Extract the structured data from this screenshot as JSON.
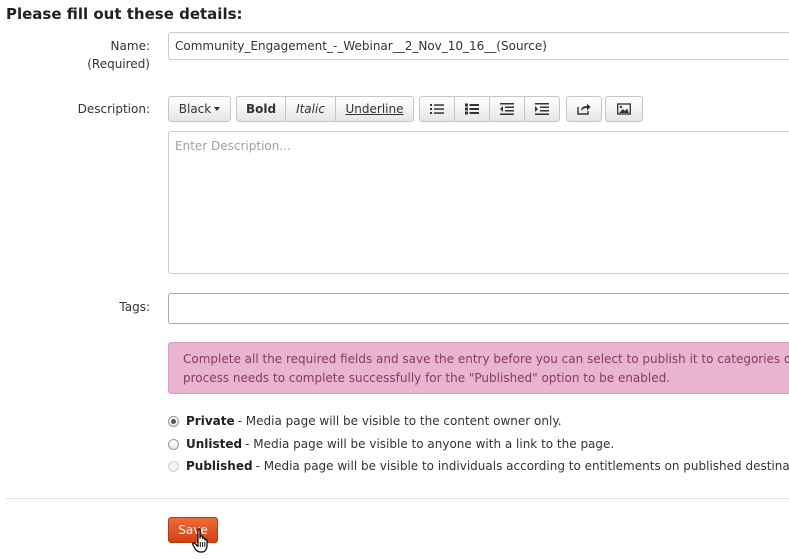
{
  "form": {
    "heading": "Please fill out these details:",
    "name": {
      "label": "Name:",
      "required_note": "(Required)",
      "value": "Community_Engagement_-_Webinar__2_Nov_10_16__(Source)"
    },
    "description": {
      "label": "Description:",
      "placeholder": "Enter Description...",
      "toolbar": {
        "color_label": "Black",
        "bold_label": "Bold",
        "italic_label": "Italic",
        "underline_label": "Underline"
      }
    },
    "tags": {
      "label": "Tags:",
      "value": ""
    },
    "alert": {
      "line1": "Complete all the required fields and save the entry before you can select to publish it to categories or chan",
      "line2": "process needs to complete successfully for the \"Published\" option to be enabled.",
      "color": "#e8b4d0"
    },
    "publish_options": [
      {
        "title": "Private",
        "desc": " - Media page will be visible to the content owner only.",
        "checked": true,
        "disabled": false
      },
      {
        "title": "Unlisted",
        "desc": " - Media page will be visible to anyone with a link to the page.",
        "checked": false,
        "disabled": false
      },
      {
        "title": "Published",
        "desc": " - Media page will be visible to individuals according to entitlements on published destinations",
        "checked": false,
        "disabled": true
      }
    ],
    "save_label": "Save",
    "save_color": "#e0521f"
  },
  "icons": [
    "unordered-list-icon",
    "ordered-list-icon",
    "outdent-icon",
    "indent-icon",
    "share-link-icon",
    "image-icon",
    "hand-cursor-icon"
  ]
}
